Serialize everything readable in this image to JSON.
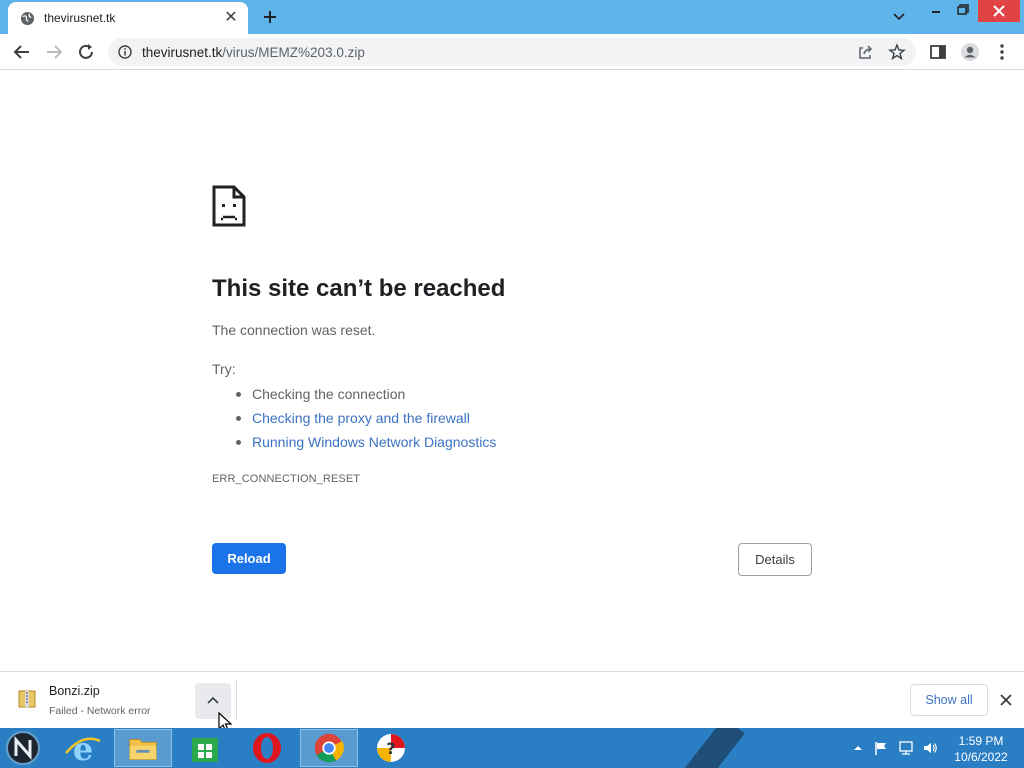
{
  "browser": {
    "tab": {
      "title": "thevirusnet.tk",
      "close_icon": "close-icon",
      "favicon": "globe-icon"
    },
    "new_tab_icon": "plus-icon",
    "tab_search_icon": "chevron-down-icon",
    "window_controls": {
      "minimize": "minimize-icon",
      "restore": "restore-icon",
      "close": "close-icon"
    },
    "omnibox": {
      "host": "thevirusnet.tk",
      "path": "/virus/MEMZ%203.0.zip",
      "security_icon": "info-icon",
      "share_icon": "share-icon",
      "bookmark_icon": "star-icon"
    },
    "toolbar_icons": [
      "back-arrow-icon",
      "forward-arrow-icon",
      "reload-icon",
      "side-panel-icon",
      "profile-icon",
      "kebab-menu-icon"
    ]
  },
  "error_page": {
    "icon": "sad-page-icon",
    "title": "This site can’t be reached",
    "description": "The connection was reset.",
    "try_label": "Try:",
    "suggestions": [
      "Checking the connection",
      "Checking the proxy and the firewall",
      "Running Windows Network Diagnostics"
    ],
    "error_code": "ERR_CONNECTION_RESET",
    "reload_label": "Reload",
    "details_label": "Details",
    "colors": {
      "primary_button": "#1a73e8",
      "link": "#3b73c4"
    }
  },
  "download_bar": {
    "filename": "Bonzi.zip",
    "status": "Failed - Network error",
    "show_all_label": "Show all",
    "file_icon": "zip-file-icon"
  },
  "taskbar": {
    "apps": [
      "start-icon",
      "internet-explorer-icon",
      "file-explorer-icon",
      "store-icon",
      "opera-icon",
      "chrome-icon",
      "bonzi-app-icon"
    ],
    "active_app": "chrome-icon",
    "tray": [
      "tray-arrow-icon",
      "action-center-flag-icon",
      "network-icon",
      "volume-icon"
    ],
    "clock": {
      "time": "1:59 PM",
      "date": "10/6/2022"
    },
    "colors": {
      "background": "#2a7fc4"
    }
  }
}
